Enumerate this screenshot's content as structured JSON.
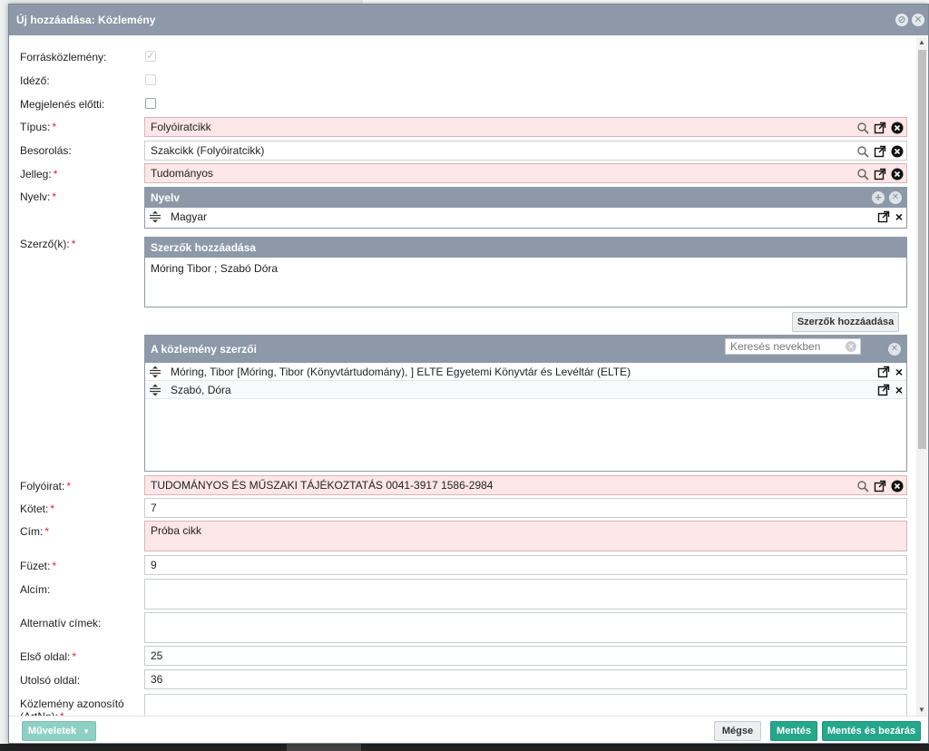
{
  "dialog": {
    "title": "Új hozzáadása: Közlemény"
  },
  "fields": {
    "forraskozlemeny": {
      "label": "Forrásközlemény:"
    },
    "idezo": {
      "label": "Idéző:"
    },
    "megjelenes_elotti": {
      "label": "Megjelenés előtti:"
    },
    "tipus": {
      "label": "Típus:",
      "value": "Folyóiratcikk"
    },
    "besorolas": {
      "label": "Besorolás:",
      "value": "Szakcikk (Folyóiratcikk)"
    },
    "jelleg": {
      "label": "Jelleg:",
      "value": "Tudományos"
    },
    "nyelv": {
      "label": "Nyelv:",
      "panel_title": "Nyelv",
      "items": [
        "Magyar"
      ]
    },
    "szerzok": {
      "label": "Szerző(k):",
      "add_panel_title": "Szerzők hozzáadása",
      "add_text": "Móring Tibor ; Szabó Dóra",
      "add_button": "Szerzők hozzáadása",
      "list_panel_title": "A közlemény szerzői",
      "search_placeholder": "Keresés nevekben",
      "items": [
        "Móring, Tibor [Móring, Tibor (Könyvtártudomány), ] ELTE Egyetemi Könyvtár és Levéltár (ELTE)",
        "Szabó, Dóra"
      ]
    },
    "folyoirat": {
      "label": "Folyóirat:",
      "value": "TUDOMÁNYOS ÉS MŰSZAKI TÁJÉKOZTATÁS 0041-3917 1586-2984"
    },
    "kotet": {
      "label": "Kötet:",
      "value": "7"
    },
    "cim": {
      "label": "Cím:",
      "value": "Próba cikk"
    },
    "fuzet": {
      "label": "Füzet:",
      "value": "9"
    },
    "alcim": {
      "label": "Alcím:",
      "value": ""
    },
    "alternativ_cimek": {
      "label": "Alternatív címek:",
      "value": ""
    },
    "elso_oldal": {
      "label": "Első oldal:",
      "value": "25"
    },
    "utolso_oldal": {
      "label": "Utolsó oldal:",
      "value": "36"
    },
    "kozlemeny_azonosito": {
      "label": "Közlemény azonosító (ArtNo):",
      "value": ""
    }
  },
  "footer": {
    "muveletek": "Műveletek",
    "megse": "Mégse",
    "mentes": "Mentés",
    "mentes_bezaras": "Mentés és bezárás"
  },
  "colors": {
    "header": "#8d99a8",
    "required_bg": "#fde6e7",
    "accent_green": "#25a78c"
  }
}
